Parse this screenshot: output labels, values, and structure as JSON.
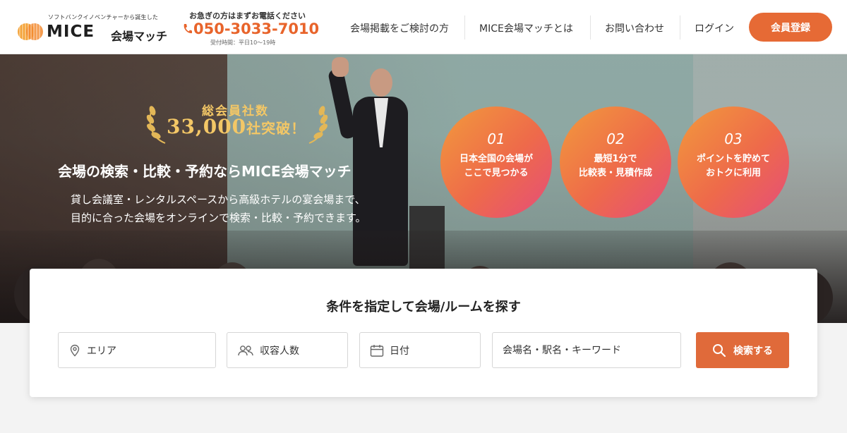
{
  "header": {
    "tagline": "ソフトバンクイノベンチャーから誕生した",
    "logo_text": "MICE",
    "logo_sub": "会場マッチ",
    "phone_note": "お急ぎの方はまずお電話ください",
    "phone_number": "050-3033-7010",
    "phone_hours": "受付時間：平日10〜19時",
    "nav": [
      {
        "label": "会場掲載をご検討の方"
      },
      {
        "label": "MICE会場マッチとは"
      },
      {
        "label": "お問い合わせ"
      },
      {
        "label": "ログイン"
      }
    ],
    "signup_label": "会員登録",
    "colors": {
      "accent": "#e66a35",
      "phone": "#e8642b"
    }
  },
  "hero": {
    "award_line1": "総会員社数",
    "award_count": "33,000",
    "award_suffix": "社突破！",
    "title": "会場の検索・比較・予約ならMICE会場マッチ",
    "desc_line1": "貸し会議室・レンタルスペースから高級ホテルの宴会場まで、",
    "desc_line2": "目的に合った会場をオンラインで検索・比較・予約できます。",
    "features": [
      {
        "num": "01",
        "line1": "日本全国の会場が",
        "line2": "ここで見つかる"
      },
      {
        "num": "02",
        "line1": "最短1分で",
        "line2": "比較表・見積作成"
      },
      {
        "num": "03",
        "line1": "ポイントを貯めて",
        "line2": "おトクに利用"
      }
    ]
  },
  "search": {
    "title": "条件を指定して会場/ルームを探す",
    "area_label": "エリア",
    "capacity_label": "収容人数",
    "date_label": "日付",
    "keyword_placeholder": "会場名・駅名・キーワード",
    "button_label": "検索する",
    "icons": [
      "map-pin-icon",
      "people-icon",
      "calendar-icon",
      "search-icon"
    ]
  }
}
